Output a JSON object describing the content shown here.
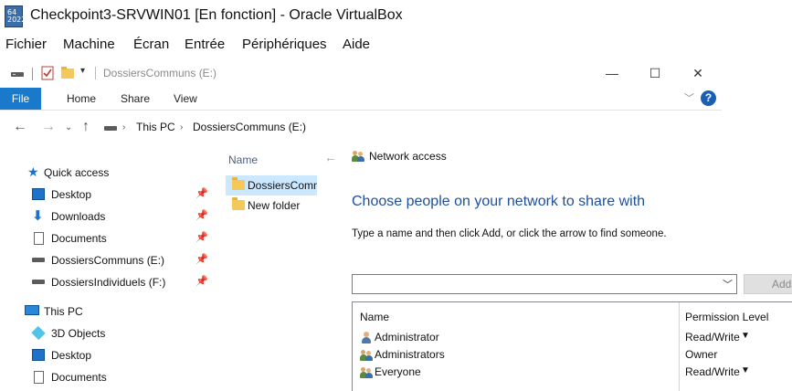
{
  "vbox": {
    "title": "Checkpoint3-SRVWIN01 [En fonction] - Oracle VirtualBox",
    "logo_text": "64\n2022",
    "menu": [
      "Fichier",
      "Machine",
      "Écran",
      "Entrée",
      "Périphériques",
      "Aide"
    ]
  },
  "explorer": {
    "window_title": "DossiersCommuns (E:)",
    "ribbon": {
      "file": "File",
      "home": "Home",
      "share": "Share",
      "view": "View",
      "help": "?"
    },
    "breadcrumb": [
      "This PC",
      "DossiersCommuns (E:)"
    ],
    "nav": {
      "quick_access": "Quick access",
      "quick_items": [
        "Desktop",
        "Downloads",
        "Documents",
        "DossiersCommuns (E:)",
        "DossiersIndividuels (F:)"
      ],
      "this_pc": "This PC",
      "pc_items": [
        "3D Objects",
        "Desktop",
        "Documents"
      ]
    },
    "files": {
      "column_name": "Name",
      "items": [
        "DossiersComm",
        "New folder"
      ]
    }
  },
  "wizard": {
    "title": "Network access",
    "heading": "Choose people on your network to share with",
    "instruction": "Type a name and then click Add, or click the arrow to find someone.",
    "combo_value": "",
    "add_button": "Add",
    "columns": {
      "name": "Name",
      "permission": "Permission Level"
    },
    "entries": [
      {
        "name": "Administrator",
        "permission": "Read/Write",
        "has_dropdown": true
      },
      {
        "name": "Administrators",
        "permission": "Owner",
        "has_dropdown": false
      },
      {
        "name": "Everyone",
        "permission": "Read/Write",
        "has_dropdown": true
      }
    ]
  },
  "colors": {
    "accent_blue": "#1979ca",
    "heading_blue": "#1e4f9c",
    "selection": "#cce8ff",
    "folder_yellow": "#f5c85a"
  }
}
